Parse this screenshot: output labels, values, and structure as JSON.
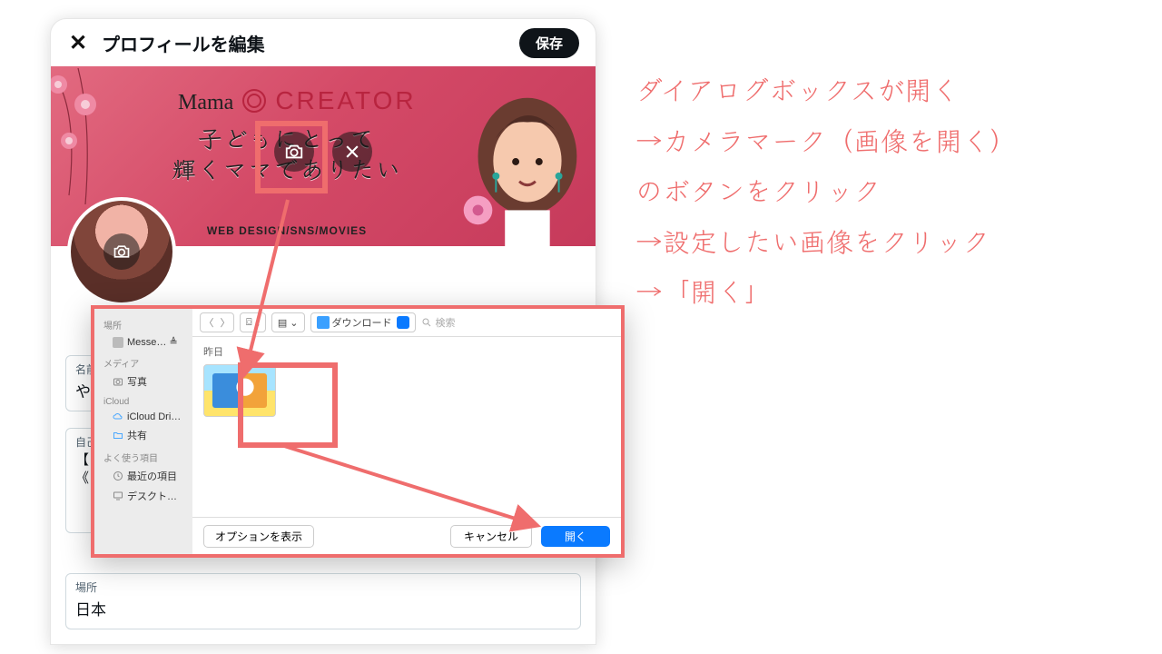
{
  "header": {
    "title": "プロフィールを編集",
    "save": "保存"
  },
  "banner": {
    "brand_script": "Mama",
    "brand_block": "CREATOR",
    "line1": "子どもにとって",
    "line2": "輝くママでありたい",
    "sub": "WEB DESIGN/SNS/MOVIES"
  },
  "fields": {
    "name_label": "名前",
    "name_value": "やま",
    "bio_label": "自己",
    "bio_line1": "【",
    "bio_line2": "《",
    "loc_label": "場所",
    "loc_value": "日本"
  },
  "dialog": {
    "groups": {
      "places": "場所",
      "media": "メディア",
      "icloud": "iCloud",
      "fav": "よく使う項目"
    },
    "items": {
      "messenger": "Messe… ≜",
      "photos": "写真",
      "icloud_drive": "iCloud Dri…",
      "shared": "共有",
      "recent": "最近の項目",
      "desktop": "デスクト…"
    },
    "toolbar": {
      "view1": "⌼ ⌄",
      "view2": "▤ ⌄",
      "location": "ダウンロード",
      "search_placeholder": "検索"
    },
    "section": "昨日",
    "buttons": {
      "options": "オプションを表示",
      "cancel": "キャンセル",
      "open": "開く"
    }
  },
  "annotation": {
    "l1": "ダイアログボックスが開く",
    "l2": "→カメラマーク（画像を開く）",
    "l3": "のボタンをクリック",
    "l4": "→設定したい画像をクリック",
    "l5": "→「開く」"
  }
}
